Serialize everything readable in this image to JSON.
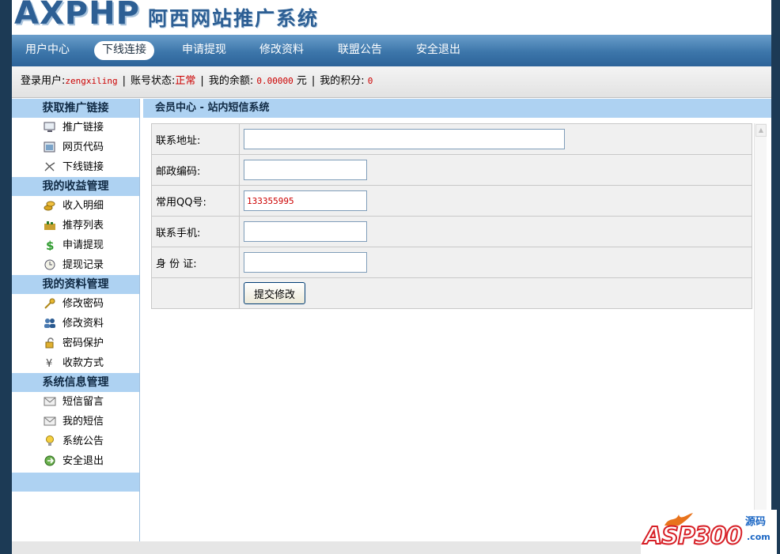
{
  "header": {
    "logo_en": "AXPHP",
    "logo_cn": "阿西网站推广系统"
  },
  "nav": {
    "items": [
      "用户中心",
      "下线连接",
      "申请提现",
      "修改资料",
      "联盟公告",
      "安全退出"
    ],
    "active": "下线连接"
  },
  "status": {
    "user_label": "登录用户:",
    "username": "zengxiling",
    "account_status_label": "账号状态:",
    "account_status": "正常",
    "balance_label": "我的余额:",
    "balance": "0.00000",
    "balance_unit": "元",
    "points_label": "我的积分:",
    "points": "0",
    "sep": "|"
  },
  "sidebar": {
    "sections": [
      {
        "title": "获取推广链接",
        "items": [
          {
            "label": "推广链接",
            "icon": "monitor-icon"
          },
          {
            "label": "网页代码",
            "icon": "webpage-icon"
          },
          {
            "label": "下线链接",
            "icon": "link-icon"
          }
        ]
      },
      {
        "title": "我的收益管理",
        "items": [
          {
            "label": "收入明细",
            "icon": "coins-icon"
          },
          {
            "label": "推荐列表",
            "icon": "chart-icon"
          },
          {
            "label": "申请提现",
            "icon": "dollar-icon"
          },
          {
            "label": "提现记录",
            "icon": "clock-icon"
          }
        ]
      },
      {
        "title": "我的资料管理",
        "items": [
          {
            "label": "修改密码",
            "icon": "key-icon"
          },
          {
            "label": "修改资料",
            "icon": "users-icon"
          },
          {
            "label": "密码保护",
            "icon": "lock-icon"
          },
          {
            "label": "收款方式",
            "icon": "yen-icon"
          }
        ]
      },
      {
        "title": "系统信息管理",
        "items": [
          {
            "label": "短信留言",
            "icon": "envelope-icon"
          },
          {
            "label": "我的短信",
            "icon": "mail-icon"
          },
          {
            "label": "系统公告",
            "icon": "bulb-icon"
          },
          {
            "label": "安全退出",
            "icon": "exit-icon"
          }
        ]
      }
    ]
  },
  "main": {
    "breadcrumb": "会员中心 - 站内短信系统",
    "form": {
      "address_label": "联系地址:",
      "address_value": "",
      "zip_label": "邮政编码:",
      "zip_value": "",
      "qq_label": "常用QQ号:",
      "qq_value": "133355995",
      "mobile_label": "联系手机:",
      "mobile_value": "",
      "idcard_label": "身 份 证:",
      "idcard_value": "",
      "submit_label": "提交修改"
    }
  },
  "watermark": {
    "brand": "ASP300",
    "cn": "源码",
    "com": ".com"
  },
  "colors": {
    "brand_blue": "#2d5f94",
    "nav_blue": "#3c76aa",
    "sidebar_head": "#aed2f2",
    "status_red": "#cc0000",
    "watermark_red": "#d71f26"
  }
}
